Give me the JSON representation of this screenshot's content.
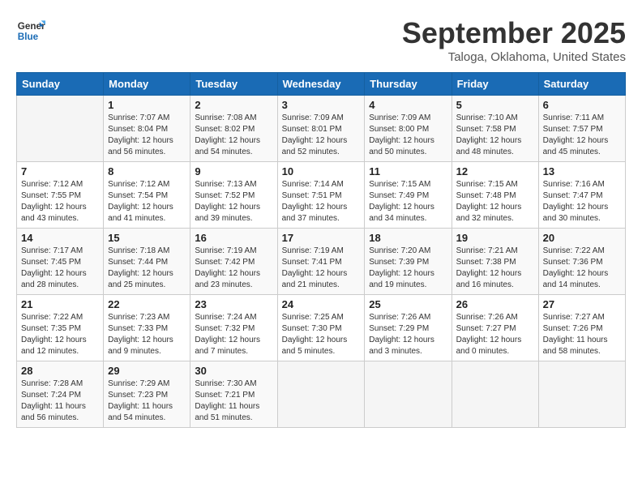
{
  "header": {
    "logo_line1": "General",
    "logo_line2": "Blue",
    "month": "September 2025",
    "location": "Taloga, Oklahoma, United States"
  },
  "days_of_week": [
    "Sunday",
    "Monday",
    "Tuesday",
    "Wednesday",
    "Thursday",
    "Friday",
    "Saturday"
  ],
  "weeks": [
    [
      {
        "day": "",
        "info": ""
      },
      {
        "day": "1",
        "info": "Sunrise: 7:07 AM\nSunset: 8:04 PM\nDaylight: 12 hours\nand 56 minutes."
      },
      {
        "day": "2",
        "info": "Sunrise: 7:08 AM\nSunset: 8:02 PM\nDaylight: 12 hours\nand 54 minutes."
      },
      {
        "day": "3",
        "info": "Sunrise: 7:09 AM\nSunset: 8:01 PM\nDaylight: 12 hours\nand 52 minutes."
      },
      {
        "day": "4",
        "info": "Sunrise: 7:09 AM\nSunset: 8:00 PM\nDaylight: 12 hours\nand 50 minutes."
      },
      {
        "day": "5",
        "info": "Sunrise: 7:10 AM\nSunset: 7:58 PM\nDaylight: 12 hours\nand 48 minutes."
      },
      {
        "day": "6",
        "info": "Sunrise: 7:11 AM\nSunset: 7:57 PM\nDaylight: 12 hours\nand 45 minutes."
      }
    ],
    [
      {
        "day": "7",
        "info": "Sunrise: 7:12 AM\nSunset: 7:55 PM\nDaylight: 12 hours\nand 43 minutes."
      },
      {
        "day": "8",
        "info": "Sunrise: 7:12 AM\nSunset: 7:54 PM\nDaylight: 12 hours\nand 41 minutes."
      },
      {
        "day": "9",
        "info": "Sunrise: 7:13 AM\nSunset: 7:52 PM\nDaylight: 12 hours\nand 39 minutes."
      },
      {
        "day": "10",
        "info": "Sunrise: 7:14 AM\nSunset: 7:51 PM\nDaylight: 12 hours\nand 37 minutes."
      },
      {
        "day": "11",
        "info": "Sunrise: 7:15 AM\nSunset: 7:49 PM\nDaylight: 12 hours\nand 34 minutes."
      },
      {
        "day": "12",
        "info": "Sunrise: 7:15 AM\nSunset: 7:48 PM\nDaylight: 12 hours\nand 32 minutes."
      },
      {
        "day": "13",
        "info": "Sunrise: 7:16 AM\nSunset: 7:47 PM\nDaylight: 12 hours\nand 30 minutes."
      }
    ],
    [
      {
        "day": "14",
        "info": "Sunrise: 7:17 AM\nSunset: 7:45 PM\nDaylight: 12 hours\nand 28 minutes."
      },
      {
        "day": "15",
        "info": "Sunrise: 7:18 AM\nSunset: 7:44 PM\nDaylight: 12 hours\nand 25 minutes."
      },
      {
        "day": "16",
        "info": "Sunrise: 7:19 AM\nSunset: 7:42 PM\nDaylight: 12 hours\nand 23 minutes."
      },
      {
        "day": "17",
        "info": "Sunrise: 7:19 AM\nSunset: 7:41 PM\nDaylight: 12 hours\nand 21 minutes."
      },
      {
        "day": "18",
        "info": "Sunrise: 7:20 AM\nSunset: 7:39 PM\nDaylight: 12 hours\nand 19 minutes."
      },
      {
        "day": "19",
        "info": "Sunrise: 7:21 AM\nSunset: 7:38 PM\nDaylight: 12 hours\nand 16 minutes."
      },
      {
        "day": "20",
        "info": "Sunrise: 7:22 AM\nSunset: 7:36 PM\nDaylight: 12 hours\nand 14 minutes."
      }
    ],
    [
      {
        "day": "21",
        "info": "Sunrise: 7:22 AM\nSunset: 7:35 PM\nDaylight: 12 hours\nand 12 minutes."
      },
      {
        "day": "22",
        "info": "Sunrise: 7:23 AM\nSunset: 7:33 PM\nDaylight: 12 hours\nand 9 minutes."
      },
      {
        "day": "23",
        "info": "Sunrise: 7:24 AM\nSunset: 7:32 PM\nDaylight: 12 hours\nand 7 minutes."
      },
      {
        "day": "24",
        "info": "Sunrise: 7:25 AM\nSunset: 7:30 PM\nDaylight: 12 hours\nand 5 minutes."
      },
      {
        "day": "25",
        "info": "Sunrise: 7:26 AM\nSunset: 7:29 PM\nDaylight: 12 hours\nand 3 minutes."
      },
      {
        "day": "26",
        "info": "Sunrise: 7:26 AM\nSunset: 7:27 PM\nDaylight: 12 hours\nand 0 minutes."
      },
      {
        "day": "27",
        "info": "Sunrise: 7:27 AM\nSunset: 7:26 PM\nDaylight: 11 hours\nand 58 minutes."
      }
    ],
    [
      {
        "day": "28",
        "info": "Sunrise: 7:28 AM\nSunset: 7:24 PM\nDaylight: 11 hours\nand 56 minutes."
      },
      {
        "day": "29",
        "info": "Sunrise: 7:29 AM\nSunset: 7:23 PM\nDaylight: 11 hours\nand 54 minutes."
      },
      {
        "day": "30",
        "info": "Sunrise: 7:30 AM\nSunset: 7:21 PM\nDaylight: 11 hours\nand 51 minutes."
      },
      {
        "day": "",
        "info": ""
      },
      {
        "day": "",
        "info": ""
      },
      {
        "day": "",
        "info": ""
      },
      {
        "day": "",
        "info": ""
      }
    ]
  ]
}
